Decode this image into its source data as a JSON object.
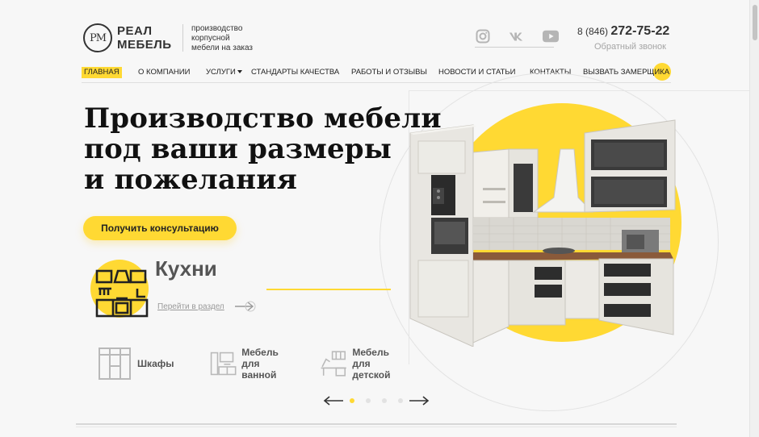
{
  "header": {
    "logo_mark": "PM",
    "logo_line1": "РЕАЛ",
    "logo_line2": "МЕБЕЛЬ",
    "tagline": [
      "производство",
      "корпусной",
      "мебели на заказ"
    ],
    "socials": [
      "instagram-icon",
      "vk-icon",
      "youtube-icon"
    ],
    "phone_code": "8 (846)",
    "phone_number": "272-75-22",
    "callback": "Обратный звонок"
  },
  "nav": {
    "items": [
      {
        "label": "ГЛАВНАЯ",
        "active": true
      },
      {
        "label": "О КОМПАНИИ"
      },
      {
        "label": "УСЛУГИ",
        "dropdown": true
      },
      {
        "label": "СТАНДАРТЫ КАЧЕСТВА"
      },
      {
        "label": "РАБОТЫ И ОТЗЫВЫ"
      },
      {
        "label": "НОВОСТИ И СТАТЬИ"
      },
      {
        "label": "КОНТАКТЫ"
      },
      {
        "label": "ВЫЗВАТЬ ЗАМЕРЩИКА"
      }
    ]
  },
  "hero": {
    "title_lines": [
      "Производство мебели",
      "под ваши размеры",
      "и пожелания"
    ],
    "cta": "Получить консультацию",
    "category_title": "Кухни",
    "category_link": "Перейти в раздел"
  },
  "categories": [
    {
      "icon": "wardrobe-icon",
      "lines": [
        "Шкафы"
      ]
    },
    {
      "icon": "bathroom-furniture-icon",
      "lines": [
        "Мебель",
        "для ванной"
      ]
    },
    {
      "icon": "kids-furniture-icon",
      "lines": [
        "Мебель",
        "для детской"
      ]
    }
  ],
  "slider": {
    "dots": 4,
    "active_index": 0
  },
  "colors": {
    "accent": "#ffd933",
    "text": "#222222",
    "muted": "#a5a5a5"
  }
}
